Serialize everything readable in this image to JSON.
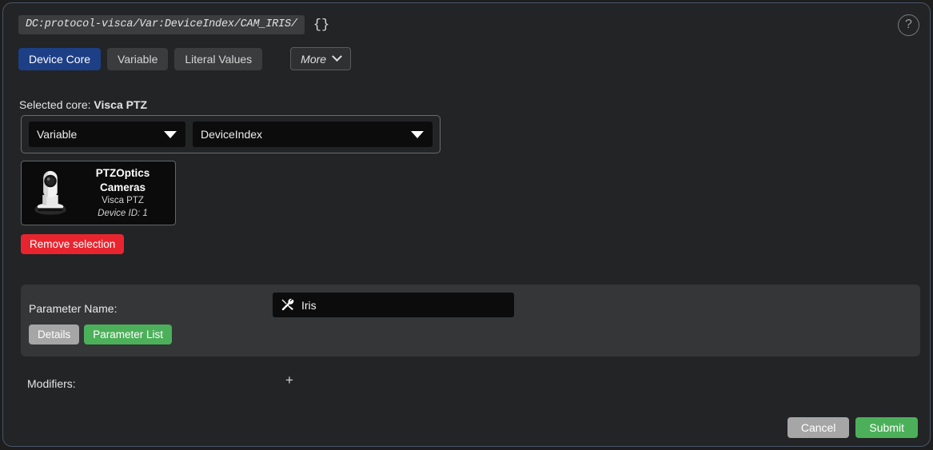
{
  "dialog": {
    "path_value": "DC:protocol-visca/Var:DeviceIndex/CAM_IRIS/",
    "path_braces": "{}",
    "help_icon": "?",
    "accent_blue": "#1d3f85",
    "accent_red": "#e8252f",
    "accent_green": "#4cb05a",
    "accent_grey": "#a6a6a6"
  },
  "tabs": [
    {
      "label": "Device Core",
      "active": true
    },
    {
      "label": "Variable",
      "active": false
    },
    {
      "label": "Literal Values",
      "active": false
    }
  ],
  "more_button": {
    "label": "More",
    "icon": "chevron-down-icon"
  },
  "selected_core": {
    "prefix": "Selected core:",
    "name": "Visca PTZ"
  },
  "selectors": [
    {
      "name": "variable",
      "value": "Variable"
    },
    {
      "name": "device-index",
      "value": "DeviceIndex"
    }
  ],
  "device_card": {
    "title": "PTZOptics Cameras",
    "subtitle": "Visca PTZ",
    "device_id": "Device ID: 1",
    "thumbnail": "ptz-camera-image"
  },
  "remove_selection": {
    "label": "Remove selection"
  },
  "parameter": {
    "label": "Parameter Name:",
    "value": "Iris",
    "value_icon": "tools-icon",
    "buttons": [
      {
        "label": "Details",
        "style": "grey"
      },
      {
        "label": "Parameter List",
        "style": "green"
      }
    ]
  },
  "modifiers": {
    "label": "Modifiers:",
    "add_label": "+"
  },
  "footer": {
    "cancel_label": "Cancel",
    "submit_label": "Submit"
  }
}
